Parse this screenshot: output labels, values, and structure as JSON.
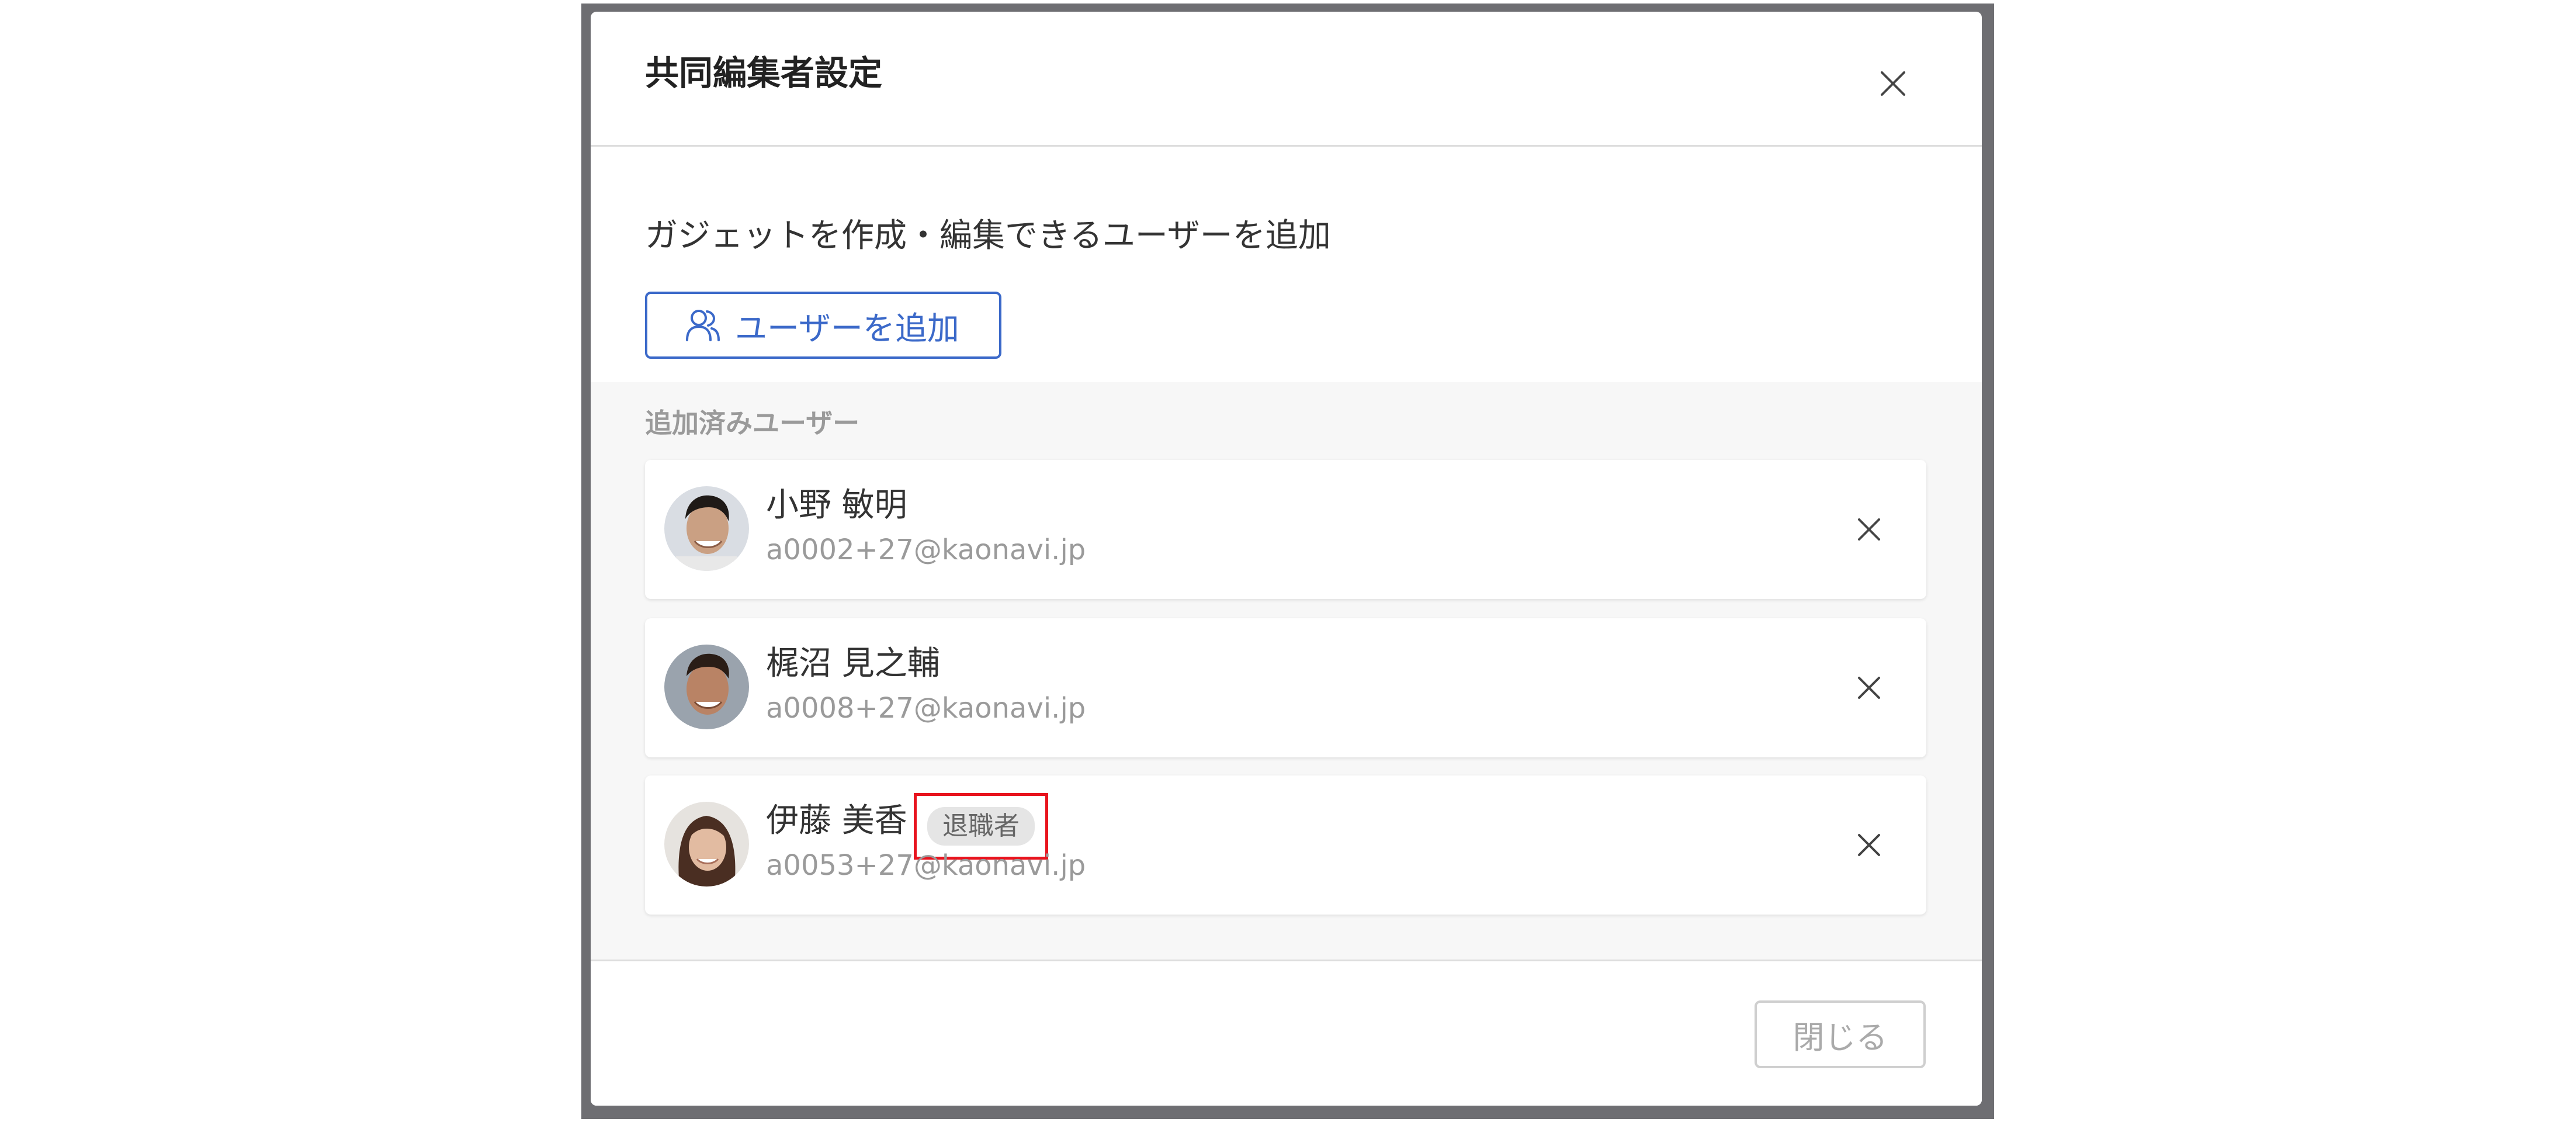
{
  "dialog": {
    "title": "共同編集者設定",
    "close_icon": "close-icon",
    "description": "ガジェットを作成・編集できるユーザーを追加",
    "add_user_button": {
      "icon": "user-group-icon",
      "label": "ユーザーを追加"
    },
    "added_users_label": "追加済みユーザー",
    "users": [
      {
        "name": "小野 敏明",
        "email": "a0002+27@kaonavi.jp",
        "avatar": "avatar-photo",
        "badge": ""
      },
      {
        "name": "梶沼 見之輔",
        "email": "a0008+27@kaonavi.jp",
        "avatar": "avatar-photo",
        "badge": ""
      },
      {
        "name": "伊藤 美香",
        "email": "a0053+27@kaonavi.jp",
        "avatar": "avatar-photo",
        "badge": "退職者"
      }
    ],
    "remove_icon": "close-icon",
    "footer": {
      "close_label": "閉じる"
    }
  },
  "colors": {
    "accent": "#3b69c9",
    "badge_highlight": "#e8141e",
    "overlay": "#6e6e72"
  }
}
